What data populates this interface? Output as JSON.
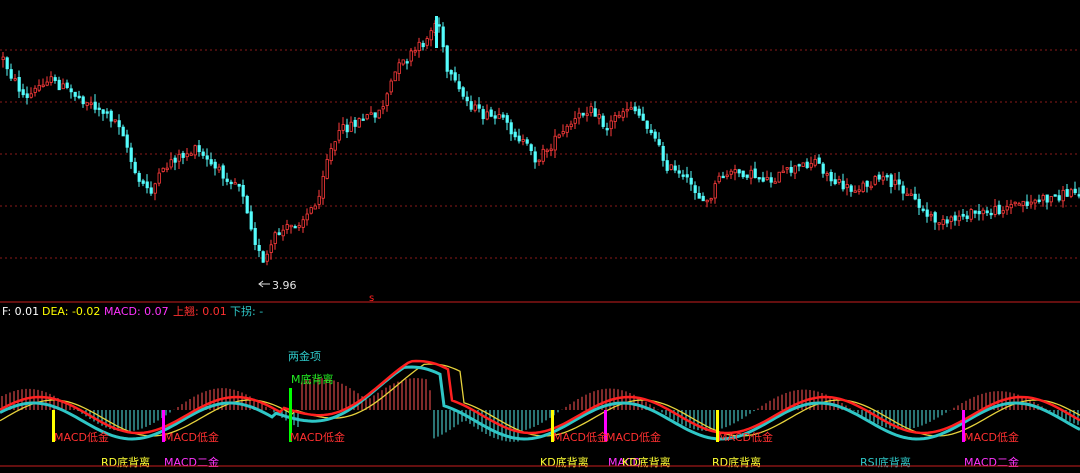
{
  "indicator_bar": {
    "dif": "F: 0.01",
    "dea": "DEA: -0.02",
    "macd": "MACD: 0.07",
    "up": "上翘: 0.01",
    "down": "下拐: -"
  },
  "colors": {
    "background": "#000000",
    "up_candle": "#ff3b3b",
    "down_candle": "#54fcfc",
    "grid": "#8a1a1a",
    "divider": "#c81e1e",
    "dif_line": "#ff2020",
    "dea_line": "#e6d23c",
    "teal_line": "#2fc6c6",
    "hist_pos": "#ff5555",
    "hist_neg": "#54e6e6",
    "bar_yellow": "#ffff00",
    "bar_magenta": "#ff00ff",
    "bar_green": "#00ff00",
    "label_red": "#ff3030",
    "label_magenta": "#ff33ff",
    "label_yellow": "#ffff33",
    "label_teal": "#2ec7c7",
    "label_green": "#22ee22"
  },
  "chart_data": {
    "type": "candlestick",
    "price_low_annotation": "3.96",
    "signal_marker": "s",
    "price_series_normalized": [
      0.62,
      0.6,
      0.56,
      0.53,
      0.55,
      0.58,
      0.6,
      0.59,
      0.58,
      0.57,
      0.55,
      0.52,
      0.49,
      0.46,
      0.45,
      0.42,
      0.4,
      0.42,
      0.39,
      0.36,
      0.33,
      0.38,
      0.4,
      0.42,
      0.39,
      0.36,
      0.38,
      0.35,
      0.31,
      0.28,
      0.24,
      0.2,
      0.15,
      0.13,
      0.17,
      0.22,
      0.25,
      0.28,
      0.31,
      0.36,
      0.4,
      0.45,
      0.48,
      0.51,
      0.54,
      0.56,
      0.6,
      0.64,
      0.7,
      0.76,
      0.8,
      0.78,
      0.74,
      0.7,
      0.66,
      0.62,
      0.59,
      0.56,
      0.54,
      0.55,
      0.57,
      0.55,
      0.52,
      0.49,
      0.47,
      0.5,
      0.53,
      0.56,
      0.59,
      0.61,
      0.58,
      0.55,
      0.52,
      0.49,
      0.46,
      0.44,
      0.43,
      0.42,
      0.43,
      0.41,
      0.4,
      0.42,
      0.43,
      0.44,
      0.43,
      0.42,
      0.41,
      0.4,
      0.38,
      0.36,
      0.37,
      0.38,
      0.39,
      0.38,
      0.37,
      0.36,
      0.34,
      0.32,
      0.31,
      0.3,
      0.31,
      0.32,
      0.33,
      0.34,
      0.35,
      0.36,
      0.37,
      0.37
    ],
    "annotations": [
      {
        "text": "两金项",
        "color": "teal"
      },
      {
        "text": "M底背离",
        "color": "green"
      },
      {
        "text": "MACD低金",
        "color": "red"
      },
      {
        "text": "MACD低金",
        "color": "red"
      },
      {
        "text": "MACD低金",
        "color": "red"
      },
      {
        "text": "MACD低金",
        "color": "red"
      },
      {
        "text": "MACD低金",
        "color": "red"
      },
      {
        "text": "MACD低金",
        "color": "red"
      },
      {
        "text": "MACD低金",
        "color": "red"
      },
      {
        "text": "RD底背离",
        "color": "yellow"
      },
      {
        "text": "MACD二金",
        "color": "magenta"
      },
      {
        "text": "KD底背离",
        "color": "yellow"
      },
      {
        "text": "MACD",
        "color": "magenta"
      },
      {
        "text": "KD底背离",
        "color": "yellow"
      },
      {
        "text": "RD底背离",
        "color": "yellow"
      },
      {
        "text": "RSI底背离",
        "color": "teal"
      },
      {
        "text": "MACD二金",
        "color": "magenta"
      }
    ]
  }
}
